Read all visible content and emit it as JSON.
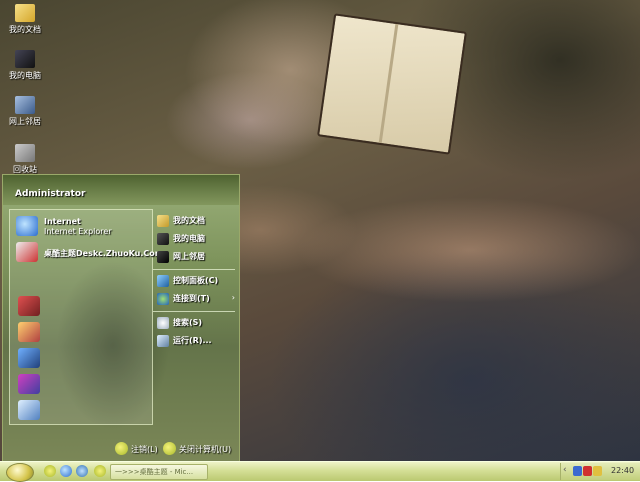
{
  "desktop": {
    "icons": [
      {
        "label": "我的文档",
        "icon": "my-documents-icon"
      },
      {
        "label": "我的电脑",
        "icon": "my-computer-icon"
      },
      {
        "label": "网上邻居",
        "icon": "network-icon"
      },
      {
        "label": "回收站",
        "icon": "recycle-bin-icon"
      }
    ]
  },
  "start_menu": {
    "user": "Administrator",
    "pinned": [
      {
        "title": "Internet",
        "subtitle": "Internet Explorer",
        "icon": "ie-icon"
      },
      {
        "title": "桌酷主题Deskc.ZhuoKu.Com",
        "subtitle": "",
        "icon": "zhuoku-icon"
      }
    ],
    "programs": [
      "books-icon",
      "paint-icon",
      "monitor-icon",
      "winrar-icon",
      "notepad-icon"
    ],
    "right": [
      {
        "label": "我的文档",
        "icon": "folder-icon"
      },
      {
        "label": "我的电脑",
        "icon": "computer-icon"
      },
      {
        "label": "网上邻居",
        "icon": "network-icon"
      },
      {
        "label": "控制面板(C)",
        "icon": "control-panel-icon"
      },
      {
        "label": "连接到(T)",
        "icon": "connect-icon",
        "arrow": "›"
      },
      {
        "label": "搜索(S)",
        "icon": "search-icon"
      },
      {
        "label": "运行(R)...",
        "icon": "run-icon"
      }
    ],
    "footer": {
      "logoff": "注销(L)",
      "shutdown": "关闭计算机(U)"
    }
  },
  "taskbar": {
    "task": "一>>>桌酷主题 - Mic...",
    "clock": "22:40",
    "tray_chevron": "‹"
  }
}
